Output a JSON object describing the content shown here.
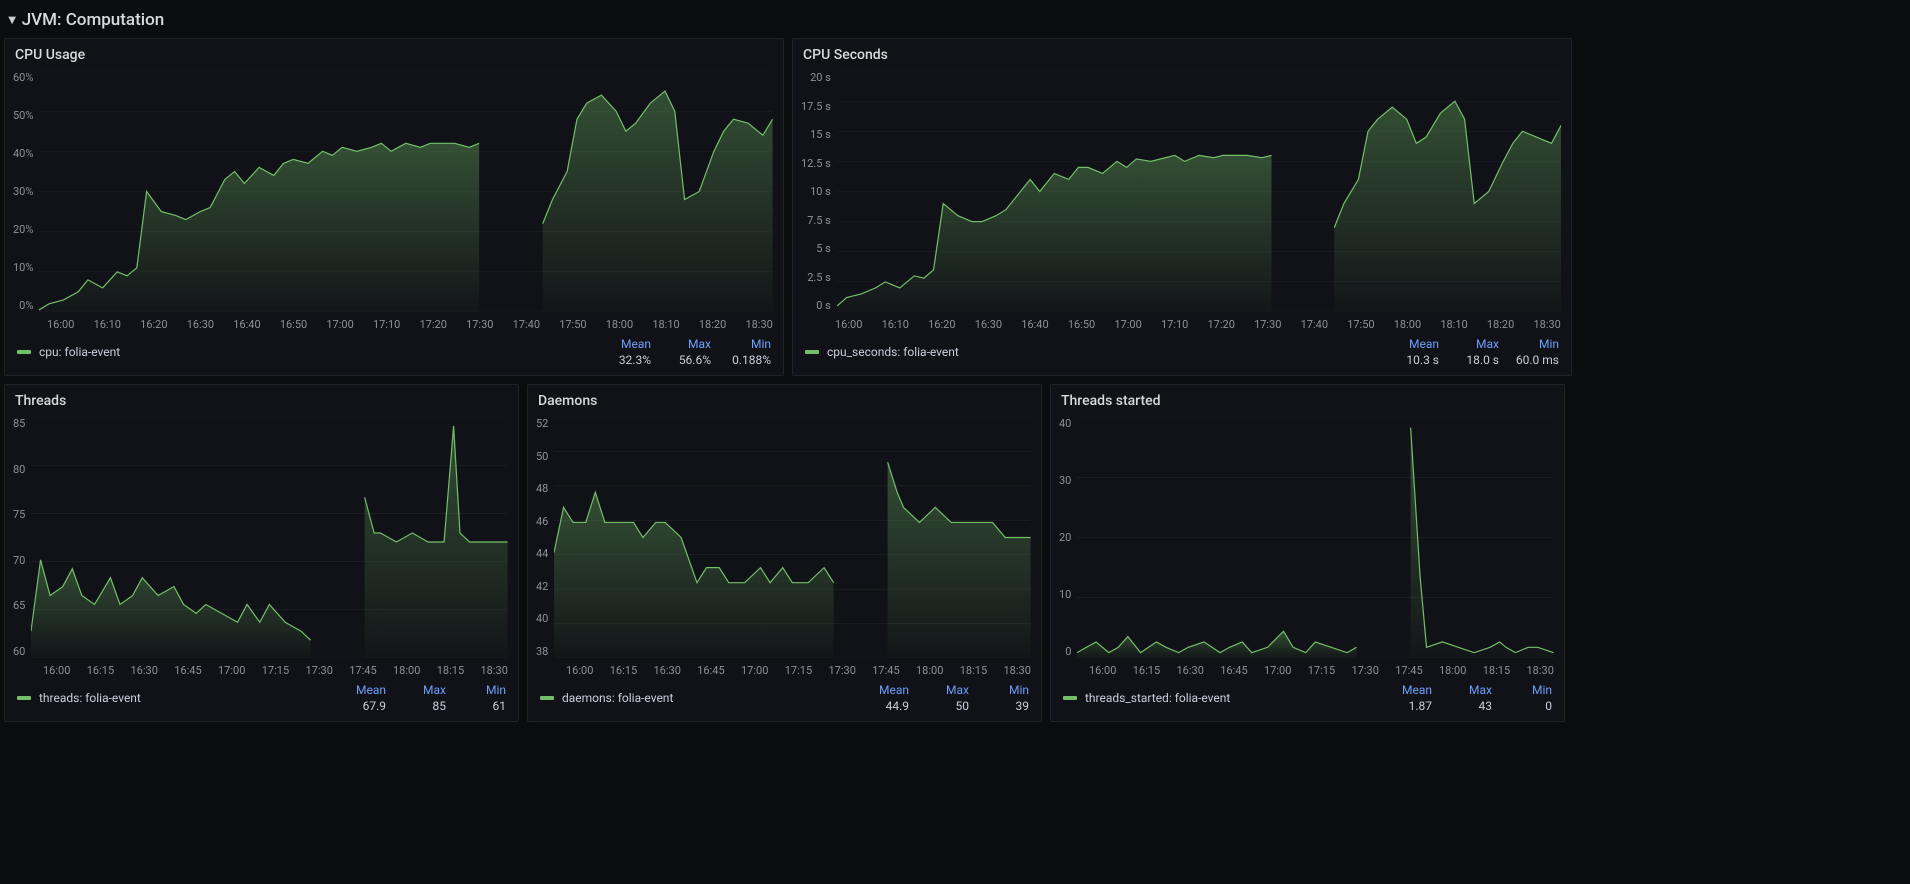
{
  "section_title": "JVM: Computation",
  "legend_headers": {
    "mean": "Mean",
    "max": "Max",
    "min": "Min"
  },
  "panels": {
    "cpu_usage": {
      "title": "CPU Usage",
      "series_name": "cpu: folia-event",
      "mean": "32.3%",
      "max": "56.6%",
      "min": "0.188%"
    },
    "cpu_seconds": {
      "title": "CPU Seconds",
      "series_name": "cpu_seconds: folia-event",
      "mean": "10.3 s",
      "max": "18.0 s",
      "min": "60.0 ms"
    },
    "threads": {
      "title": "Threads",
      "series_name": "threads: folia-event",
      "mean": "67.9",
      "max": "85",
      "min": "61"
    },
    "daemons": {
      "title": "Daemons",
      "series_name": "daemons: folia-event",
      "mean": "44.9",
      "max": "50",
      "min": "39"
    },
    "threads_started": {
      "title": "Threads started",
      "series_name": "threads_started: folia-event",
      "mean": "1.87",
      "max": "43",
      "min": "0"
    }
  },
  "chart_data": [
    {
      "id": "cpu_usage",
      "type": "area",
      "title": "CPU Usage",
      "x_ticks": [
        "16:00",
        "16:10",
        "16:20",
        "16:30",
        "16:40",
        "16:50",
        "17:00",
        "17:10",
        "17:20",
        "17:30",
        "17:40",
        "17:50",
        "18:00",
        "18:10",
        "18:20",
        "18:30"
      ],
      "y_ticks": [
        "0%",
        "10%",
        "20%",
        "30%",
        "40%",
        "50%",
        "60%"
      ],
      "ylim": [
        0,
        60
      ],
      "x": [
        "16:00",
        "16:02",
        "16:05",
        "16:08",
        "16:10",
        "16:13",
        "16:16",
        "16:18",
        "16:20",
        "16:22",
        "16:25",
        "16:28",
        "16:30",
        "16:33",
        "16:35",
        "16:38",
        "16:40",
        "16:42",
        "16:45",
        "16:48",
        "16:50",
        "16:52",
        "16:55",
        "16:58",
        "17:00",
        "17:02",
        "17:05",
        "17:08",
        "17:10",
        "17:12",
        "17:15",
        "17:18",
        "17:20",
        "17:22",
        "17:25",
        "17:28",
        "17:30",
        "17:41",
        "17:43",
        "17:45",
        "17:48",
        "17:50",
        "17:52",
        "17:55",
        "17:58",
        "18:00",
        "18:02",
        "18:05",
        "18:08",
        "18:10",
        "18:12",
        "18:15",
        "18:18",
        "18:20",
        "18:22",
        "18:25",
        "18:28",
        "18:30"
      ],
      "values": [
        0.5,
        2,
        3,
        5,
        8,
        6,
        10,
        9,
        11,
        30,
        25,
        24,
        23,
        25,
        26,
        33,
        35,
        32,
        36,
        34,
        37,
        38,
        37,
        40,
        39,
        41,
        40,
        41,
        42,
        40,
        42,
        41,
        42,
        42,
        42,
        41,
        42,
        15,
        22,
        28,
        35,
        48,
        52,
        54,
        50,
        45,
        47,
        52,
        55,
        50,
        28,
        30,
        40,
        45,
        48,
        47,
        44,
        48
      ],
      "gap": [
        [
          37,
          38
        ]
      ]
    },
    {
      "id": "cpu_seconds",
      "type": "area",
      "title": "CPU Seconds",
      "x_ticks": [
        "16:00",
        "16:10",
        "16:20",
        "16:30",
        "16:40",
        "16:50",
        "17:00",
        "17:10",
        "17:20",
        "17:30",
        "17:40",
        "17:50",
        "18:00",
        "18:10",
        "18:20",
        "18:30"
      ],
      "y_ticks": [
        "0 s",
        "2.5 s",
        "5 s",
        "7.5 s",
        "10 s",
        "12.5 s",
        "15 s",
        "17.5 s",
        "20 s"
      ],
      "ylim": [
        0,
        20
      ],
      "x": [
        "16:00",
        "16:02",
        "16:05",
        "16:08",
        "16:10",
        "16:13",
        "16:16",
        "16:18",
        "16:20",
        "16:22",
        "16:25",
        "16:28",
        "16:30",
        "16:33",
        "16:35",
        "16:38",
        "16:40",
        "16:42",
        "16:45",
        "16:48",
        "16:50",
        "16:52",
        "16:55",
        "16:58",
        "17:00",
        "17:02",
        "17:05",
        "17:08",
        "17:10",
        "17:12",
        "17:15",
        "17:18",
        "17:20",
        "17:22",
        "17:25",
        "17:28",
        "17:30",
        "17:41",
        "17:43",
        "17:45",
        "17:48",
        "17:50",
        "17:52",
        "17:55",
        "17:58",
        "18:00",
        "18:02",
        "18:05",
        "18:08",
        "18:10",
        "18:12",
        "18:15",
        "18:18",
        "18:20",
        "18:22",
        "18:25",
        "18:28",
        "18:30"
      ],
      "values": [
        0.5,
        1.2,
        1.5,
        2,
        2.5,
        2,
        3,
        2.8,
        3.5,
        9,
        8,
        7.5,
        7.5,
        8,
        8.5,
        10,
        11,
        10,
        11.5,
        11,
        12,
        12,
        11.5,
        12.5,
        12,
        12.7,
        12.5,
        12.8,
        13,
        12.5,
        13,
        12.8,
        13,
        13,
        13,
        12.8,
        13,
        5,
        7,
        9,
        11,
        15,
        16,
        17,
        16,
        14,
        14.5,
        16.5,
        17.5,
        16,
        9,
        10,
        12.5,
        14,
        15,
        14.5,
        14,
        15.5
      ],
      "gap": [
        [
          37,
          38
        ]
      ]
    },
    {
      "id": "threads",
      "type": "area",
      "title": "Threads",
      "x_ticks": [
        "16:00",
        "16:15",
        "16:30",
        "16:45",
        "17:00",
        "17:15",
        "17:30",
        "17:45",
        "18:00",
        "18:15",
        "18:30"
      ],
      "y_ticks": [
        "60",
        "65",
        "70",
        "75",
        "80",
        "85"
      ],
      "ylim": [
        59,
        86
      ],
      "x": [
        "16:00",
        "16:03",
        "16:06",
        "16:10",
        "16:13",
        "16:16",
        "16:20",
        "16:25",
        "16:28",
        "16:32",
        "16:35",
        "16:40",
        "16:45",
        "16:48",
        "16:52",
        "16:55",
        "17:00",
        "17:05",
        "17:08",
        "17:12",
        "17:15",
        "17:20",
        "17:25",
        "17:28",
        "17:30",
        "17:45",
        "17:48",
        "17:50",
        "17:55",
        "18:00",
        "18:05",
        "18:10",
        "18:13",
        "18:15",
        "18:18",
        "18:22",
        "18:25",
        "18:30"
      ],
      "values": [
        62,
        70,
        66,
        67,
        69,
        66,
        65,
        68,
        65,
        66,
        68,
        66,
        67,
        65,
        64,
        65,
        64,
        63,
        65,
        63,
        65,
        63,
        62,
        61,
        63,
        77,
        73,
        73,
        72,
        73,
        72,
        72,
        85,
        73,
        72,
        72,
        72,
        72
      ],
      "gap": [
        [
          24,
          25
        ]
      ]
    },
    {
      "id": "daemons",
      "type": "area",
      "title": "Daemons",
      "x_ticks": [
        "16:00",
        "16:15",
        "16:30",
        "16:45",
        "17:00",
        "17:15",
        "17:30",
        "17:45",
        "18:00",
        "18:15",
        "18:30"
      ],
      "y_ticks": [
        "38",
        "40",
        "42",
        "44",
        "46",
        "48",
        "50",
        "52"
      ],
      "ylim": [
        37,
        53
      ],
      "x": [
        "16:00",
        "16:03",
        "16:06",
        "16:10",
        "16:13",
        "16:16",
        "16:20",
        "16:25",
        "16:28",
        "16:32",
        "16:35",
        "16:40",
        "16:45",
        "16:48",
        "16:52",
        "16:55",
        "17:00",
        "17:05",
        "17:08",
        "17:12",
        "17:15",
        "17:20",
        "17:25",
        "17:28",
        "17:30",
        "17:45",
        "17:48",
        "17:50",
        "17:55",
        "18:00",
        "18:05",
        "18:10",
        "18:13",
        "18:15",
        "18:18",
        "18:22",
        "18:25",
        "18:30"
      ],
      "values": [
        44,
        47,
        46,
        46,
        48,
        46,
        46,
        46,
        45,
        46,
        46,
        45,
        42,
        43,
        43,
        42,
        42,
        43,
        42,
        43,
        42,
        42,
        43,
        42,
        39,
        50,
        48,
        47,
        46,
        47,
        46,
        46,
        46,
        46,
        46,
        45,
        45,
        45
      ],
      "gap": [
        [
          24,
          25
        ]
      ]
    },
    {
      "id": "threads_started",
      "type": "area",
      "title": "Threads started",
      "x_ticks": [
        "16:00",
        "16:15",
        "16:30",
        "16:45",
        "17:00",
        "17:15",
        "17:30",
        "17:45",
        "18:00",
        "18:15",
        "18:30"
      ],
      "y_ticks": [
        "0",
        "10",
        "20",
        "30",
        "40"
      ],
      "ylim": [
        0,
        45
      ],
      "x": [
        "16:00",
        "16:03",
        "16:06",
        "16:10",
        "16:13",
        "16:16",
        "16:20",
        "16:25",
        "16:28",
        "16:32",
        "16:35",
        "16:40",
        "16:45",
        "16:48",
        "16:52",
        "16:55",
        "17:00",
        "17:05",
        "17:08",
        "17:12",
        "17:15",
        "17:20",
        "17:25",
        "17:28",
        "17:30",
        "17:45",
        "17:48",
        "17:50",
        "17:55",
        "18:00",
        "18:05",
        "18:10",
        "18:13",
        "18:15",
        "18:18",
        "18:22",
        "18:25",
        "18:30"
      ],
      "values": [
        1,
        2,
        3,
        1,
        2,
        4,
        1,
        3,
        2,
        1,
        2,
        3,
        1,
        2,
        3,
        1,
        2,
        5,
        2,
        1,
        3,
        2,
        1,
        2,
        0,
        43,
        15,
        2,
        3,
        2,
        1,
        2,
        3,
        2,
        1,
        2,
        2,
        1
      ],
      "gap": [
        [
          24,
          25
        ]
      ]
    }
  ]
}
